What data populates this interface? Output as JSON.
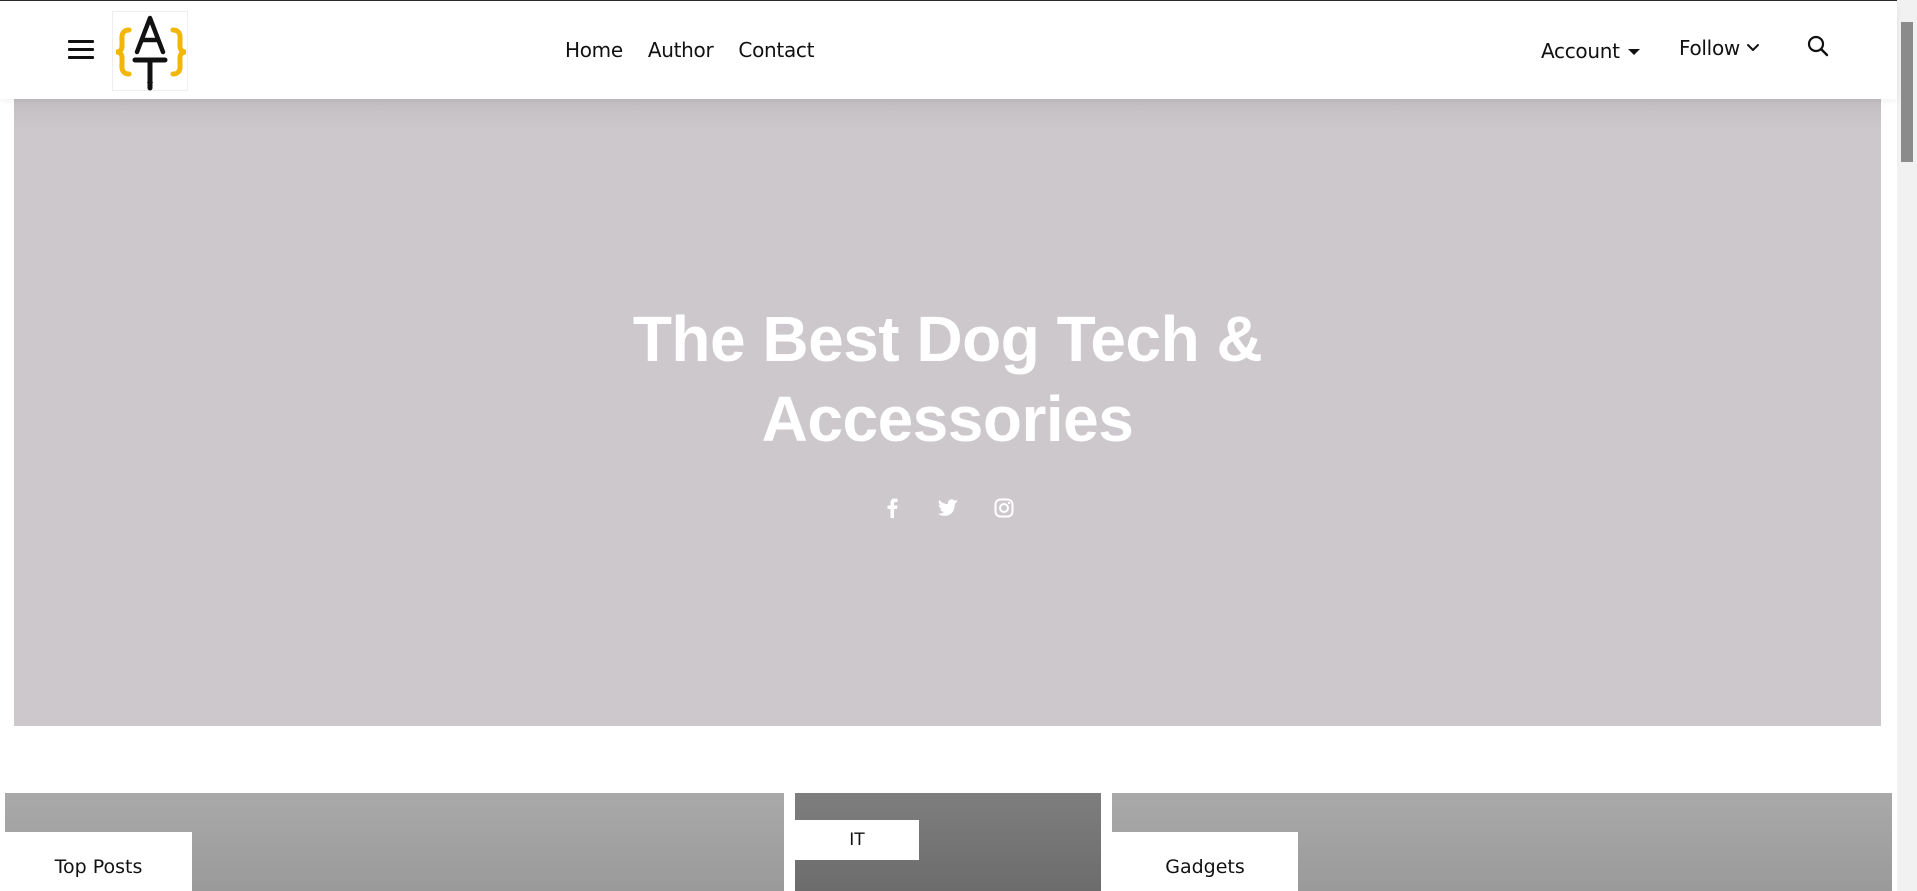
{
  "header": {
    "menu_icon": "hamburger-menu-icon",
    "logo_icon": "at-logo-icon",
    "nav": [
      {
        "label": "Home"
      },
      {
        "label": "Author"
      },
      {
        "label": "Contact"
      }
    ],
    "account_label": "Account",
    "follow_label": "Follow",
    "search_icon": "search-icon"
  },
  "hero": {
    "title_line1": "The Best Dog Tech &",
    "title_line2": "Accessories",
    "socials": [
      "facebook-icon",
      "twitter-icon",
      "instagram-icon"
    ]
  },
  "cards": [
    {
      "label": "Top Posts"
    },
    {
      "label": "IT"
    },
    {
      "label": "Gadgets"
    }
  ],
  "colors": {
    "hero_bg": "#cdc8cc",
    "logo_accent": "#f2b705",
    "text": "#111111"
  }
}
